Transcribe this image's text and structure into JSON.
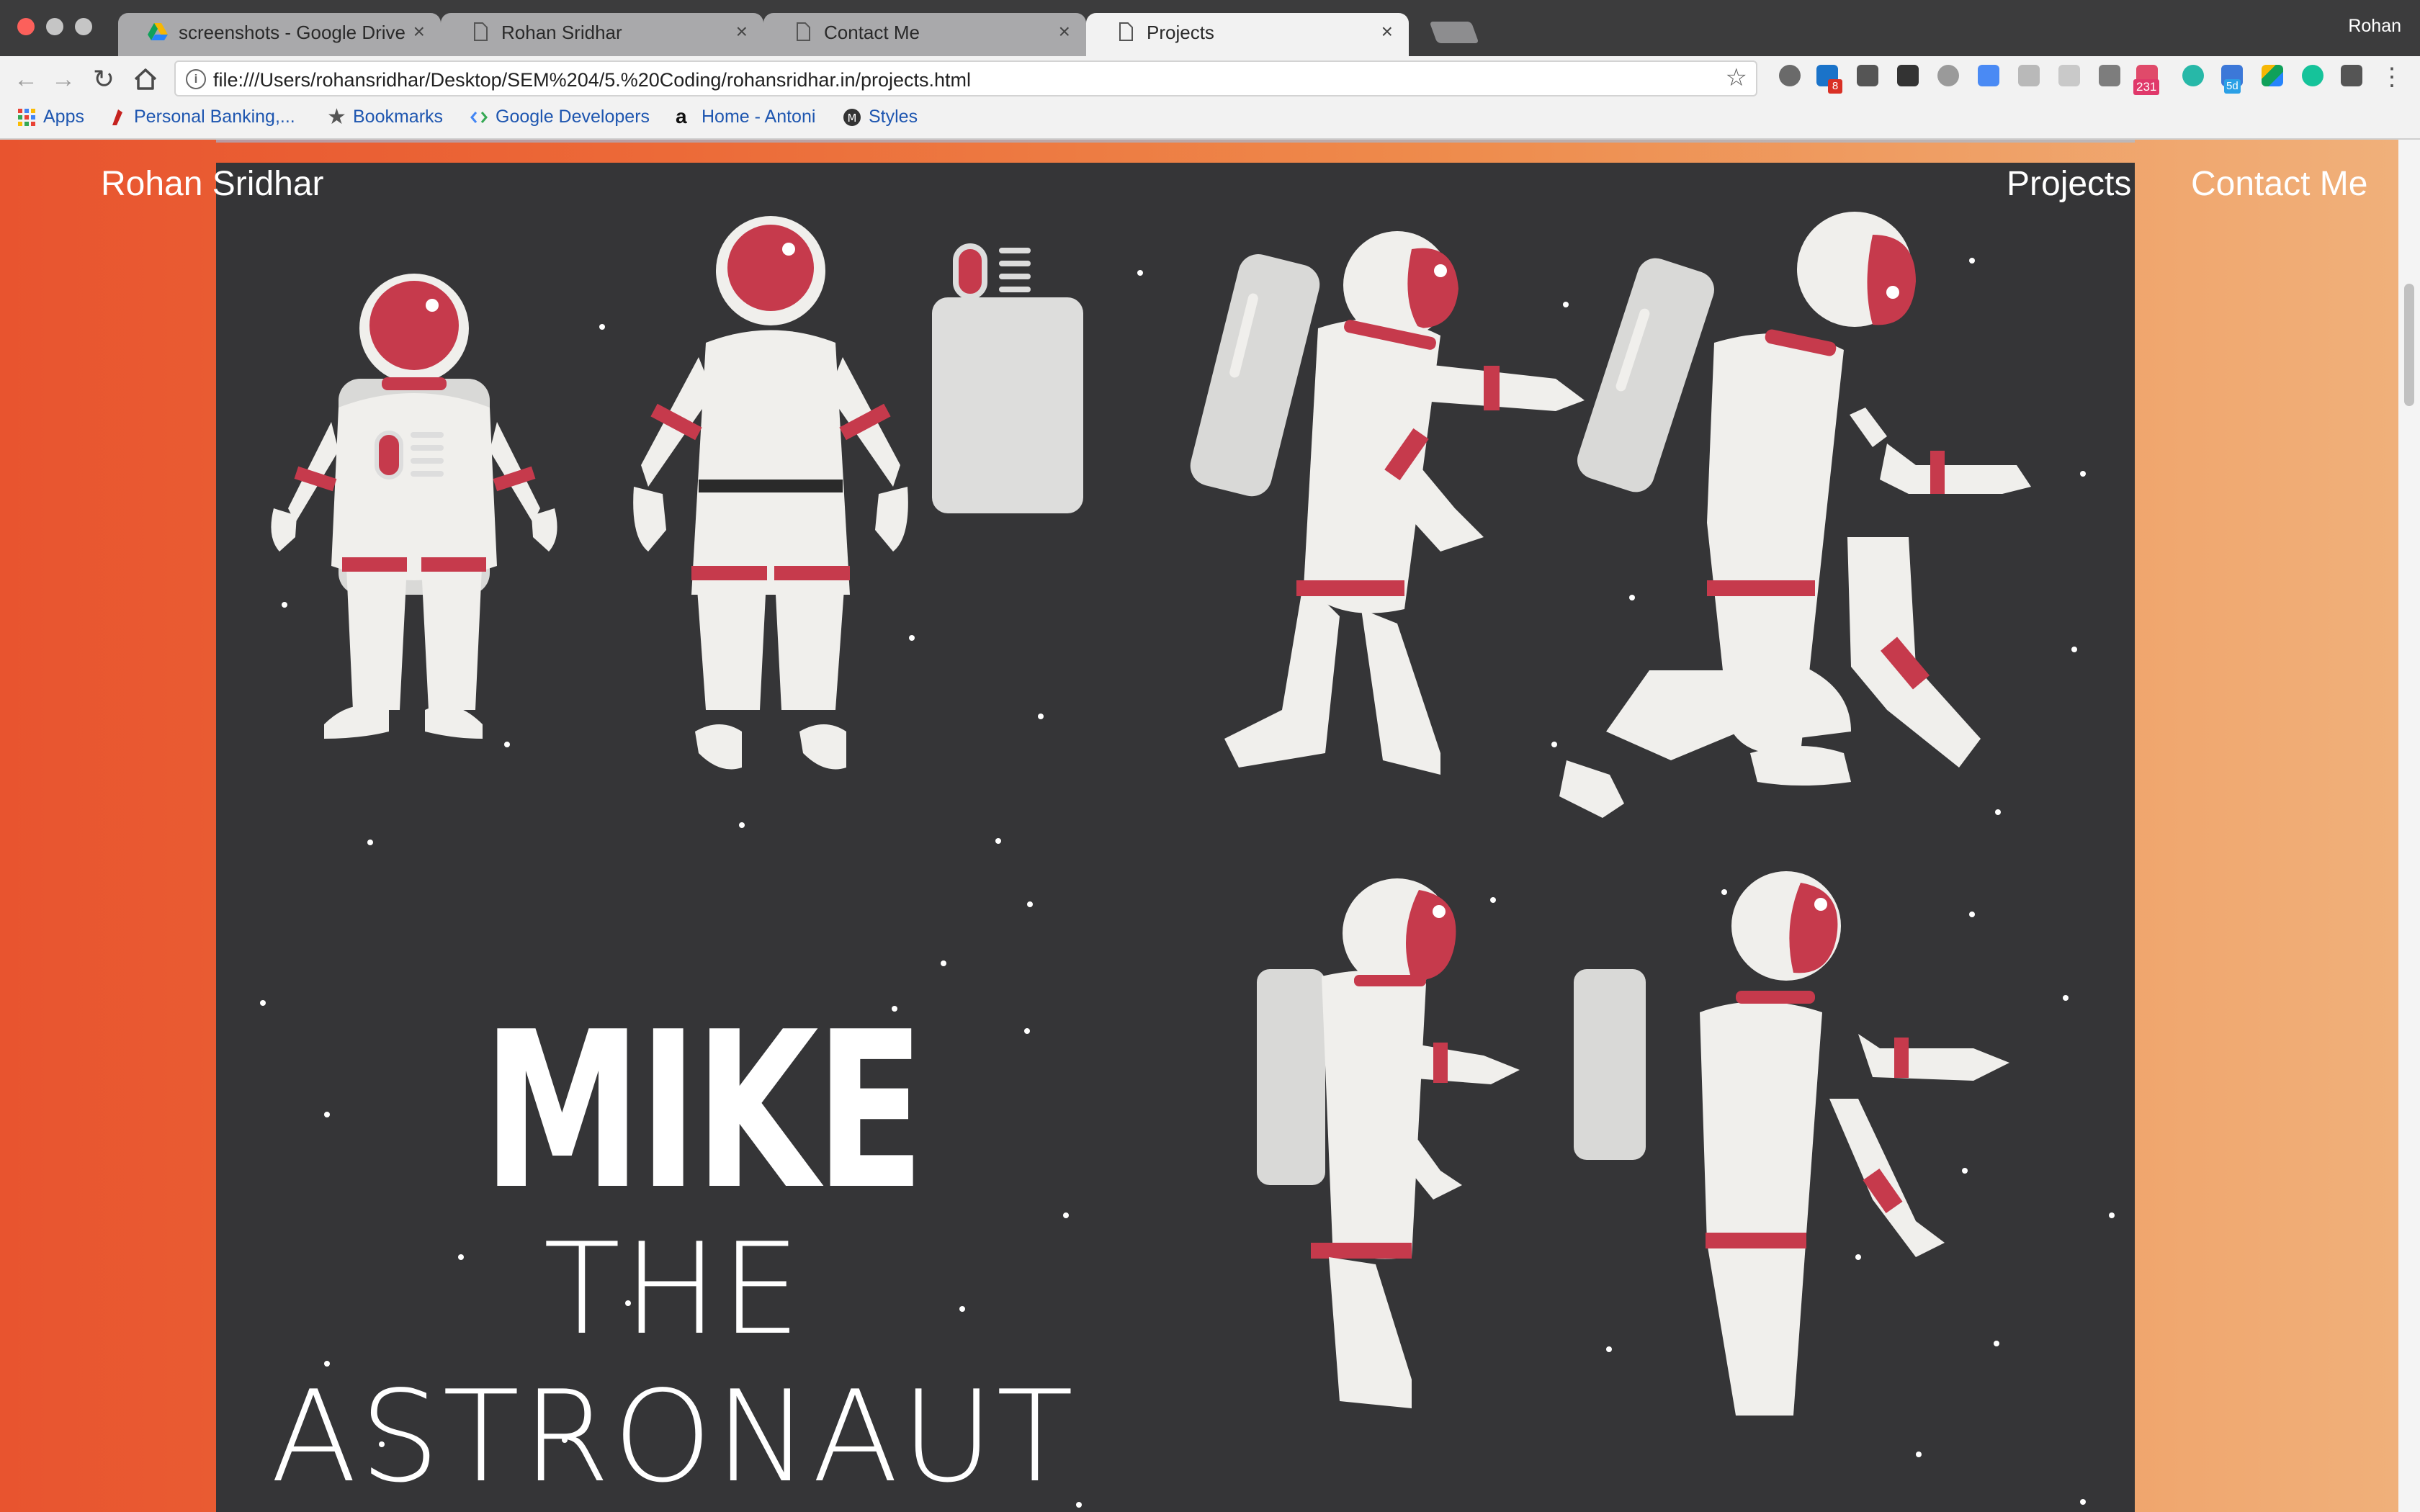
{
  "browser": {
    "tabs": [
      {
        "title": "screenshots - Google Drive",
        "active": false,
        "icon": "google-drive-icon"
      },
      {
        "title": "Rohan Sridhar",
        "active": false,
        "icon": "page-icon"
      },
      {
        "title": "Contact Me",
        "active": false,
        "icon": "page-icon"
      },
      {
        "title": "Projects",
        "active": true,
        "icon": "page-icon"
      }
    ],
    "close_glyph": "×",
    "profile_name": "Rohan",
    "url": "file:///Users/rohansridhar/Desktop/SEM%204/5.%20Coding/rohansridhar.in/projects.html",
    "extension_badges": {
      "mail_count": "8",
      "calendar_count": "231",
      "sd_label": "5d"
    },
    "bookmarks": [
      {
        "label": "Apps",
        "icon": "apps-grid-icon"
      },
      {
        "label": "Personal Banking,...",
        "icon": "bank-icon"
      },
      {
        "label": "Bookmarks",
        "icon": "star-icon"
      },
      {
        "label": "Google Developers",
        "icon": "google-developers-icon"
      },
      {
        "label": "Home - Antoni",
        "icon": "amazon-icon"
      },
      {
        "label": "Styles",
        "icon": "materialize-icon"
      }
    ]
  },
  "site": {
    "name": "Rohan Sridhar",
    "nav": {
      "projects": "Projects",
      "contact": "Contact Me"
    },
    "hero": {
      "title_bold": "MIKE",
      "title_line2": "THE",
      "title_line3": "ASTRONAUT"
    }
  },
  "colors": {
    "hero_bg": "#353537",
    "suit": "#f0efec",
    "suit_shade": "#d9d9d7",
    "accent_red": "#c63a4c",
    "visor": "#c63a4c",
    "gradient_left": "#e8542f",
    "gradient_right": "#f0b07a"
  }
}
